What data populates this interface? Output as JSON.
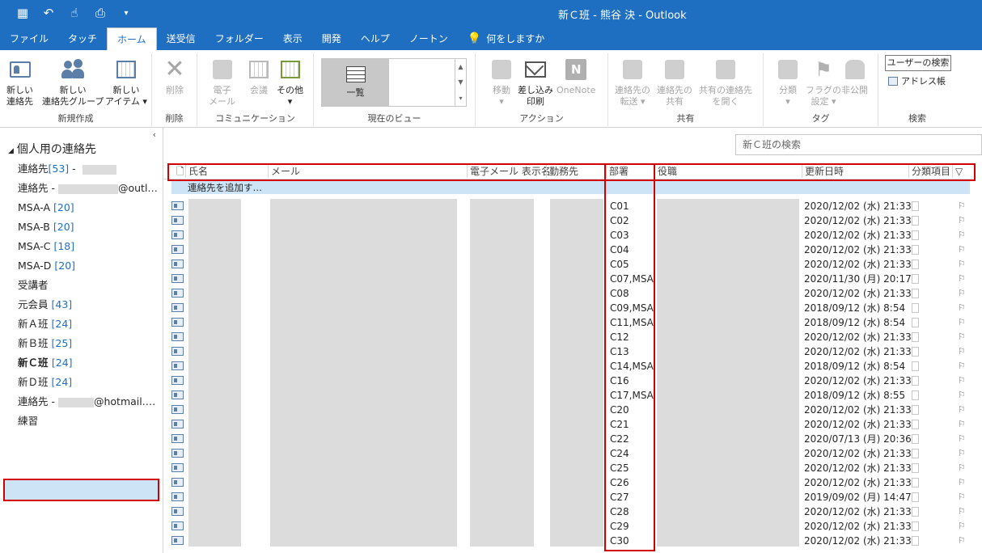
{
  "window": {
    "title": "新Ｃ班 - 熊谷 決 - Outlook"
  },
  "quick_access": {
    "icons": [
      "contacts-icon",
      "undo-icon",
      "touch-mode-icon",
      "print-icon",
      "customize-icon"
    ]
  },
  "tabs": [
    {
      "label": "ファイル"
    },
    {
      "label": "タッチ"
    },
    {
      "label": "ホーム",
      "active": true
    },
    {
      "label": "送受信"
    },
    {
      "label": "フォルダー"
    },
    {
      "label": "表示"
    },
    {
      "label": "開発"
    },
    {
      "label": "ヘルプ"
    },
    {
      "label": "ノートン"
    },
    {
      "label": "何をしますか"
    }
  ],
  "ribbon": {
    "new_group": {
      "label": "新規作成",
      "new_contact": "新しい\n連絡先",
      "new_group": "新しい\n連絡先グループ",
      "new_item": "新しい\nアイテム ▾"
    },
    "delete_group": {
      "label": "削除",
      "delete": "削除"
    },
    "comm_group": {
      "label": "コミュニケーション",
      "email": "電子\nメール",
      "meeting": "会議",
      "more": "その他\n▾"
    },
    "view_group": {
      "label": "現在のビュー",
      "list": "一覧"
    },
    "action_group": {
      "label": "アクション",
      "move": "移動\n▾",
      "mail_merge": "差し込み\n印刷",
      "onenote": "OneNote"
    },
    "share_group": {
      "label": "共有",
      "forward": "連絡先の\n転送 ▾",
      "share": "連絡先の\n共有",
      "open_shared": "共有の連絡先\nを開く"
    },
    "tags_group": {
      "label": "タグ",
      "categorize": "分類\n▾",
      "followup": "フラグの\n設定 ▾",
      "private": "非公開"
    },
    "find_group": {
      "label": "検索",
      "search_people": "ユーザーの検索",
      "address_book": "アドレス帳"
    }
  },
  "folders": {
    "header": "個人用の連絡先",
    "items": [
      {
        "name": "連絡先",
        "count": "[53]",
        "suffix": " - "
      },
      {
        "name": "連絡先 - ",
        "count": "",
        "suffix": "@outl…"
      },
      {
        "name": "MSA-A",
        "count": "[20]",
        "suffix": ""
      },
      {
        "name": "MSA-B",
        "count": "[20]",
        "suffix": ""
      },
      {
        "name": "MSA-C",
        "count": "[18]",
        "suffix": ""
      },
      {
        "name": "MSA-D",
        "count": "[20]",
        "suffix": ""
      },
      {
        "name": "受講者",
        "count": "",
        "suffix": ""
      },
      {
        "name": "元会員",
        "count": "[43]",
        "suffix": ""
      },
      {
        "name": "新Ａ班",
        "count": "[24]",
        "suffix": ""
      },
      {
        "name": "新Ｂ班",
        "count": "[25]",
        "suffix": ""
      },
      {
        "name": "新Ｃ班",
        "count": "[24]",
        "suffix": "",
        "selected": true
      },
      {
        "name": "新Ｄ班",
        "count": "[24]",
        "suffix": ""
      },
      {
        "name": "連絡先 - ",
        "count": "",
        "suffix": "@hotmail.…"
      },
      {
        "name": "練習",
        "count": "",
        "suffix": ""
      }
    ]
  },
  "search": {
    "placeholder": "新Ｃ班の検索"
  },
  "columns": [
    "氏名",
    "メール",
    "電子メール 表示名",
    "勤務先",
    "部署",
    "役職",
    "更新日時",
    "分類項目"
  ],
  "add_contact": "連絡先を追加す…",
  "contacts": [
    {
      "dept": "C01",
      "updated": "2020/12/02 (水) 21:33"
    },
    {
      "dept": "C02",
      "updated": "2020/12/02 (水) 21:33"
    },
    {
      "dept": "C03",
      "updated": "2020/12/02 (水) 21:33"
    },
    {
      "dept": "C04",
      "updated": "2020/12/02 (水) 21:33"
    },
    {
      "dept": "C05",
      "updated": "2020/12/02 (水) 21:33"
    },
    {
      "dept": "C07,MSA",
      "updated": "2020/11/30 (月) 20:17"
    },
    {
      "dept": "C08",
      "updated": "2020/12/02 (水) 21:33"
    },
    {
      "dept": "C09,MSA",
      "updated": "2018/09/12 (水) 8:54"
    },
    {
      "dept": "C11,MSA",
      "updated": "2018/09/12 (水) 8:54"
    },
    {
      "dept": "C12",
      "updated": "2020/12/02 (水) 21:33"
    },
    {
      "dept": "C13",
      "updated": "2020/12/02 (水) 21:33"
    },
    {
      "dept": "C14,MSA",
      "updated": "2018/09/12 (水) 8:54"
    },
    {
      "dept": "C16",
      "updated": "2020/12/02 (水) 21:33"
    },
    {
      "dept": "C17,MSA",
      "updated": "2018/09/12 (水) 8:55"
    },
    {
      "dept": "C20",
      "updated": "2020/12/02 (水) 21:33"
    },
    {
      "dept": "C21",
      "updated": "2020/12/02 (水) 21:33"
    },
    {
      "dept": "C22",
      "updated": "2020/07/13 (月) 20:36"
    },
    {
      "dept": "C24",
      "updated": "2020/12/02 (水) 21:33"
    },
    {
      "dept": "C25",
      "updated": "2020/12/02 (水) 21:33"
    },
    {
      "dept": "C26",
      "updated": "2020/12/02 (水) 21:33"
    },
    {
      "dept": "C27",
      "updated": "2019/09/02 (月) 14:47"
    },
    {
      "dept": "C28",
      "updated": "2020/12/02 (水) 21:33"
    },
    {
      "dept": "C29",
      "updated": "2020/12/02 (水) 21:33"
    },
    {
      "dept": "C30",
      "updated": "2020/12/02 (水) 21:33"
    }
  ],
  "colors": {
    "accent": "#1e6fc2",
    "highlight": "#d40000",
    "selection": "#cde4f7"
  }
}
